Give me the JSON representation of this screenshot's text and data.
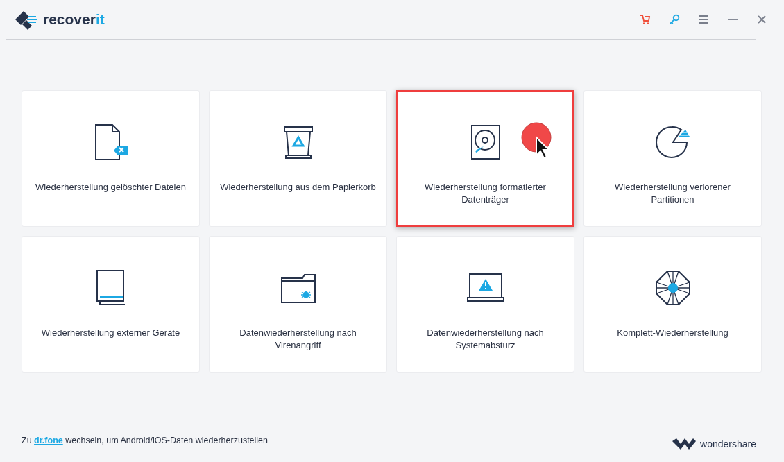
{
  "header": {
    "brand_main": "recover",
    "brand_accent": "it",
    "actions": [
      {
        "kind": "cart"
      },
      {
        "kind": "key"
      },
      {
        "kind": "menu"
      },
      {
        "kind": "minimize"
      },
      {
        "kind": "close"
      }
    ]
  },
  "cards": [
    {
      "kind": "deleted-file",
      "label": "Wiederherstellung gelöschter Dateien",
      "selected": false
    },
    {
      "kind": "recycle-bin",
      "label": "Wiederherstellung aus dem Papierkorb",
      "selected": false
    },
    {
      "kind": "hard-disk",
      "label": "Wiederherstellung formatierter Datenträger",
      "selected": true
    },
    {
      "kind": "partition",
      "label": "Wiederherstellung verlorener Partitionen",
      "selected": false
    },
    {
      "kind": "external-device",
      "label": "Wiederherstellung externer Geräte",
      "selected": false
    },
    {
      "kind": "virus-folder",
      "label": "Datenwiederherstellung nach Virenangriff",
      "selected": false
    },
    {
      "kind": "crash",
      "label": "Datenwiederherstellung nach Systemabsturz",
      "selected": false
    },
    {
      "kind": "complete",
      "label": "Komplett-Wiederherstellung",
      "selected": false
    }
  ],
  "footer": {
    "prefix": "Zu ",
    "link": "dr.fone",
    "suffix": " wechseln, um Android/iOS-Daten wiederherzustellen",
    "company": "wondershare"
  }
}
